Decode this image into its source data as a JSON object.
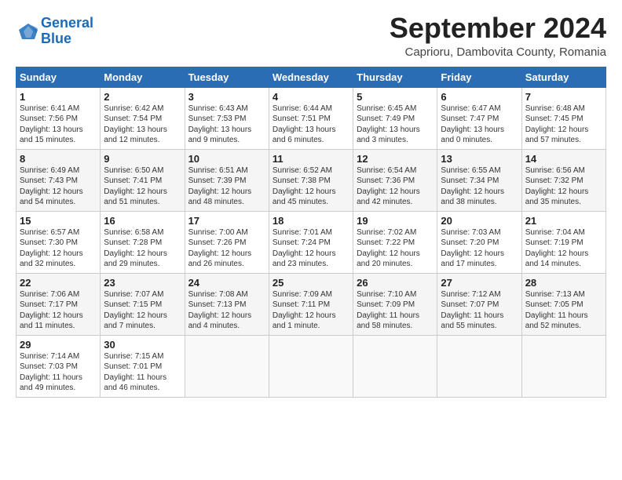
{
  "header": {
    "logo_line1": "General",
    "logo_line2": "Blue",
    "month_title": "September 2024",
    "location": "Caprioru, Dambovita County, Romania"
  },
  "columns": [
    "Sunday",
    "Monday",
    "Tuesday",
    "Wednesday",
    "Thursday",
    "Friday",
    "Saturday"
  ],
  "weeks": [
    [
      {
        "day": "1",
        "lines": [
          "Sunrise: 6:41 AM",
          "Sunset: 7:56 PM",
          "Daylight: 13 hours",
          "and 15 minutes."
        ]
      },
      {
        "day": "2",
        "lines": [
          "Sunrise: 6:42 AM",
          "Sunset: 7:54 PM",
          "Daylight: 13 hours",
          "and 12 minutes."
        ]
      },
      {
        "day": "3",
        "lines": [
          "Sunrise: 6:43 AM",
          "Sunset: 7:53 PM",
          "Daylight: 13 hours",
          "and 9 minutes."
        ]
      },
      {
        "day": "4",
        "lines": [
          "Sunrise: 6:44 AM",
          "Sunset: 7:51 PM",
          "Daylight: 13 hours",
          "and 6 minutes."
        ]
      },
      {
        "day": "5",
        "lines": [
          "Sunrise: 6:45 AM",
          "Sunset: 7:49 PM",
          "Daylight: 13 hours",
          "and 3 minutes."
        ]
      },
      {
        "day": "6",
        "lines": [
          "Sunrise: 6:47 AM",
          "Sunset: 7:47 PM",
          "Daylight: 13 hours",
          "and 0 minutes."
        ]
      },
      {
        "day": "7",
        "lines": [
          "Sunrise: 6:48 AM",
          "Sunset: 7:45 PM",
          "Daylight: 12 hours",
          "and 57 minutes."
        ]
      }
    ],
    [
      {
        "day": "8",
        "lines": [
          "Sunrise: 6:49 AM",
          "Sunset: 7:43 PM",
          "Daylight: 12 hours",
          "and 54 minutes."
        ]
      },
      {
        "day": "9",
        "lines": [
          "Sunrise: 6:50 AM",
          "Sunset: 7:41 PM",
          "Daylight: 12 hours",
          "and 51 minutes."
        ]
      },
      {
        "day": "10",
        "lines": [
          "Sunrise: 6:51 AM",
          "Sunset: 7:39 PM",
          "Daylight: 12 hours",
          "and 48 minutes."
        ]
      },
      {
        "day": "11",
        "lines": [
          "Sunrise: 6:52 AM",
          "Sunset: 7:38 PM",
          "Daylight: 12 hours",
          "and 45 minutes."
        ]
      },
      {
        "day": "12",
        "lines": [
          "Sunrise: 6:54 AM",
          "Sunset: 7:36 PM",
          "Daylight: 12 hours",
          "and 42 minutes."
        ]
      },
      {
        "day": "13",
        "lines": [
          "Sunrise: 6:55 AM",
          "Sunset: 7:34 PM",
          "Daylight: 12 hours",
          "and 38 minutes."
        ]
      },
      {
        "day": "14",
        "lines": [
          "Sunrise: 6:56 AM",
          "Sunset: 7:32 PM",
          "Daylight: 12 hours",
          "and 35 minutes."
        ]
      }
    ],
    [
      {
        "day": "15",
        "lines": [
          "Sunrise: 6:57 AM",
          "Sunset: 7:30 PM",
          "Daylight: 12 hours",
          "and 32 minutes."
        ]
      },
      {
        "day": "16",
        "lines": [
          "Sunrise: 6:58 AM",
          "Sunset: 7:28 PM",
          "Daylight: 12 hours",
          "and 29 minutes."
        ]
      },
      {
        "day": "17",
        "lines": [
          "Sunrise: 7:00 AM",
          "Sunset: 7:26 PM",
          "Daylight: 12 hours",
          "and 26 minutes."
        ]
      },
      {
        "day": "18",
        "lines": [
          "Sunrise: 7:01 AM",
          "Sunset: 7:24 PM",
          "Daylight: 12 hours",
          "and 23 minutes."
        ]
      },
      {
        "day": "19",
        "lines": [
          "Sunrise: 7:02 AM",
          "Sunset: 7:22 PM",
          "Daylight: 12 hours",
          "and 20 minutes."
        ]
      },
      {
        "day": "20",
        "lines": [
          "Sunrise: 7:03 AM",
          "Sunset: 7:20 PM",
          "Daylight: 12 hours",
          "and 17 minutes."
        ]
      },
      {
        "day": "21",
        "lines": [
          "Sunrise: 7:04 AM",
          "Sunset: 7:19 PM",
          "Daylight: 12 hours",
          "and 14 minutes."
        ]
      }
    ],
    [
      {
        "day": "22",
        "lines": [
          "Sunrise: 7:06 AM",
          "Sunset: 7:17 PM",
          "Daylight: 12 hours",
          "and 11 minutes."
        ]
      },
      {
        "day": "23",
        "lines": [
          "Sunrise: 7:07 AM",
          "Sunset: 7:15 PM",
          "Daylight: 12 hours",
          "and 7 minutes."
        ]
      },
      {
        "day": "24",
        "lines": [
          "Sunrise: 7:08 AM",
          "Sunset: 7:13 PM",
          "Daylight: 12 hours",
          "and 4 minutes."
        ]
      },
      {
        "day": "25",
        "lines": [
          "Sunrise: 7:09 AM",
          "Sunset: 7:11 PM",
          "Daylight: 12 hours",
          "and 1 minute."
        ]
      },
      {
        "day": "26",
        "lines": [
          "Sunrise: 7:10 AM",
          "Sunset: 7:09 PM",
          "Daylight: 11 hours",
          "and 58 minutes."
        ]
      },
      {
        "day": "27",
        "lines": [
          "Sunrise: 7:12 AM",
          "Sunset: 7:07 PM",
          "Daylight: 11 hours",
          "and 55 minutes."
        ]
      },
      {
        "day": "28",
        "lines": [
          "Sunrise: 7:13 AM",
          "Sunset: 7:05 PM",
          "Daylight: 11 hours",
          "and 52 minutes."
        ]
      }
    ],
    [
      {
        "day": "29",
        "lines": [
          "Sunrise: 7:14 AM",
          "Sunset: 7:03 PM",
          "Daylight: 11 hours",
          "and 49 minutes."
        ]
      },
      {
        "day": "30",
        "lines": [
          "Sunrise: 7:15 AM",
          "Sunset: 7:01 PM",
          "Daylight: 11 hours",
          "and 46 minutes."
        ]
      },
      null,
      null,
      null,
      null,
      null
    ]
  ]
}
